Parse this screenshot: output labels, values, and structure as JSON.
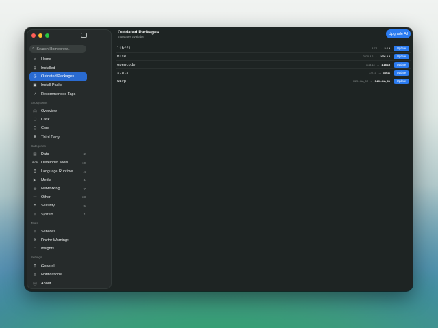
{
  "search": {
    "placeholder": "Search Homebrew..."
  },
  "nav": {
    "main": [
      {
        "label": "Home",
        "icon": "home-icon"
      },
      {
        "label": "Installed",
        "icon": "grid-icon"
      },
      {
        "label": "Outdated Packages",
        "icon": "clock-icon",
        "active": true
      },
      {
        "label": "Install Packs",
        "icon": "box-icon"
      },
      {
        "label": "Recommended Taps",
        "icon": "check-circle-icon"
      }
    ],
    "ecosystems_title": "Ecosystems",
    "ecosystems": [
      {
        "label": "Overview",
        "icon": "info-icon"
      },
      {
        "label": "Cask",
        "icon": "cube-icon"
      },
      {
        "label": "Core",
        "icon": "cube-icon"
      },
      {
        "label": "Third-Party",
        "icon": "puzzle-icon"
      }
    ],
    "categories_title": "Categories",
    "categories": [
      {
        "label": "Data",
        "count": "2",
        "icon": "doc-icon"
      },
      {
        "label": "Developer Tools",
        "count": "10",
        "icon": "code-icon"
      },
      {
        "label": "Language Runtime",
        "count": "4",
        "icon": "braces-icon"
      },
      {
        "label": "Media",
        "count": "1",
        "icon": "play-icon"
      },
      {
        "label": "Networking",
        "count": "7",
        "icon": "globe-icon"
      },
      {
        "label": "Other",
        "count": "33",
        "icon": "ellipsis-icon"
      },
      {
        "label": "Security",
        "count": "5",
        "icon": "shield-icon"
      },
      {
        "label": "System",
        "count": "1",
        "icon": "gears-icon"
      }
    ],
    "tools_title": "Tools",
    "tools": [
      {
        "label": "Services",
        "icon": "gears-icon"
      },
      {
        "label": "Doctor Warnings",
        "icon": "stethoscope-icon"
      },
      {
        "label": "Insights",
        "icon": "lightbulb-icon"
      }
    ],
    "settings_title": "Settings",
    "settings": [
      {
        "label": "General",
        "icon": "gear-icon"
      },
      {
        "label": "Notifications",
        "icon": "bell-icon"
      },
      {
        "label": "About",
        "icon": "info-icon"
      }
    ]
  },
  "header": {
    "title": "Outdated Packages",
    "subtitle": "5 updates available",
    "upgrade_all": "Upgrade All"
  },
  "packages": [
    {
      "name": "libffi",
      "old": "3.7.1",
      "arrow": "→",
      "new": "3.6.0",
      "action": "Update"
    },
    {
      "name": "mise",
      "old": "2026.8.2",
      "arrow": "→",
      "new": "2026.8.3",
      "action": "Update"
    },
    {
      "name": "opencode",
      "old": "1.18.13",
      "arrow": "→",
      "new": "1.18.15",
      "action": "Update"
    },
    {
      "name": "stats",
      "old": "3.0.10",
      "arrow": "→",
      "new": "3.0.11",
      "action": "Update"
    },
    {
      "name": "warp",
      "old": "0.20...bla_03",
      "arrow": "→",
      "new": "0.20...bla_01",
      "action": "Update"
    }
  ],
  "colors": {
    "accent": "#2b7bf0",
    "active_item": "#2a6bd1",
    "window_bg": "#1e2423",
    "sidebar_bg": "#262b2b"
  }
}
